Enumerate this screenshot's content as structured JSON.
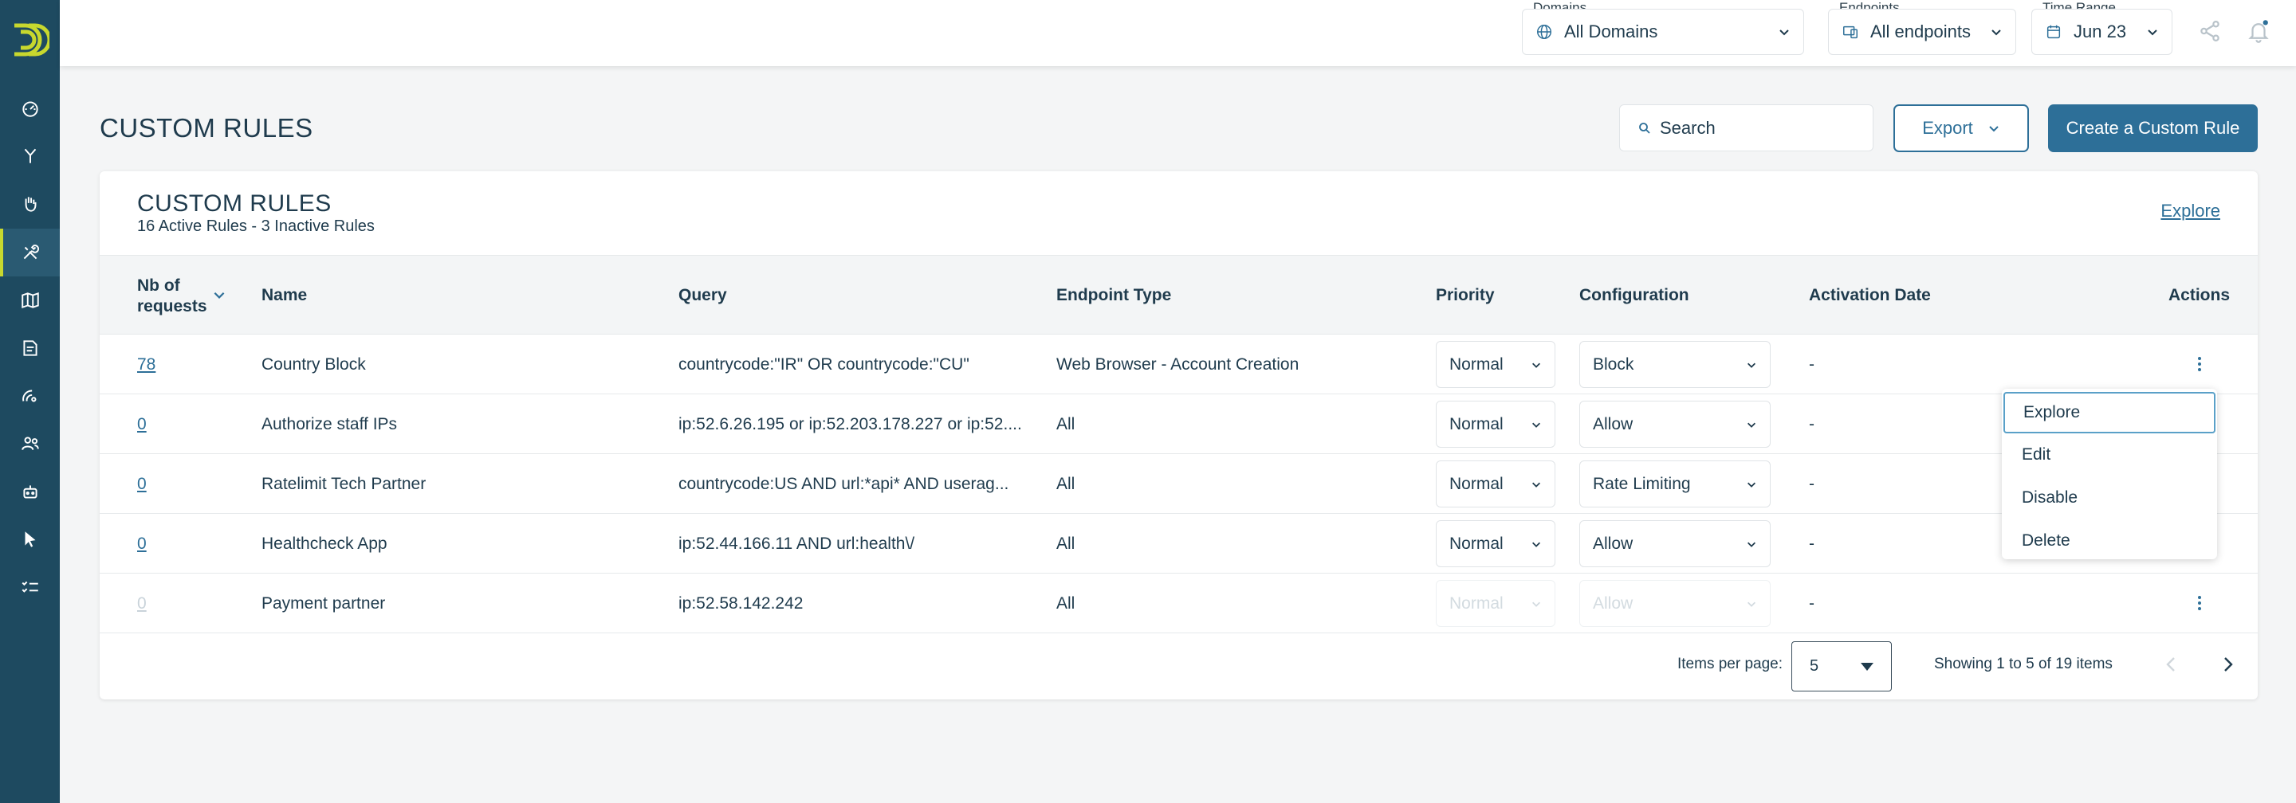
{
  "header": {
    "domains": {
      "label": "Domains",
      "value": "All Domains",
      "icon": "globe-icon"
    },
    "endpoints": {
      "label": "Endpoints",
      "value": "All endpoints",
      "icon": "endpoint-icon"
    },
    "time_range": {
      "label": "Time Range",
      "value": "Jun 23",
      "icon": "calendar-icon"
    },
    "icons": [
      "share-icon",
      "bell-icon"
    ],
    "notification_dot_color": "#2d6f98"
  },
  "sidebar": {
    "items": [
      {
        "icon": "dashboard-icon"
      },
      {
        "icon": "branch-icon"
      },
      {
        "icon": "hand-icon"
      },
      {
        "icon": "tools-icon",
        "active": true
      },
      {
        "icon": "map-icon"
      },
      {
        "icon": "document-icon"
      },
      {
        "icon": "radar-icon"
      },
      {
        "icon": "users-icon"
      },
      {
        "icon": "robot-icon"
      },
      {
        "icon": "cursor-icon"
      },
      {
        "icon": "checklist-icon"
      }
    ]
  },
  "page": {
    "title": "CUSTOM RULES",
    "search_placeholder": "Search",
    "export_label": "Export",
    "create_label": "Create a Custom Rule"
  },
  "card": {
    "title": "CUSTOM RULES",
    "subtitle": "16 Active Rules - 3 Inactive Rules",
    "explore_link": "Explore"
  },
  "table": {
    "columns": {
      "requests_line1": "Nb of",
      "requests_line2": "requests",
      "name": "Name",
      "query": "Query",
      "endpoint_type": "Endpoint Type",
      "priority": "Priority",
      "configuration": "Configuration",
      "activation_date": "Activation Date",
      "actions": "Actions"
    },
    "rows": [
      {
        "requests": "78",
        "name": "Country Block",
        "query": "countrycode:\"IR\" OR countrycode:\"CU\"",
        "endpoint_type": "Web Browser - Account Creation",
        "priority": "Normal",
        "configuration": "Block",
        "activation_date": "-",
        "active": true
      },
      {
        "requests": "0",
        "name": "Authorize staff IPs",
        "query": "ip:52.6.26.195 or ip:52.203.178.227 or ip:52....",
        "endpoint_type": "All",
        "priority": "Normal",
        "configuration": "Allow",
        "activation_date": "-",
        "active": true
      },
      {
        "requests": "0",
        "name": "Ratelimit Tech Partner",
        "query": "countrycode:US AND url:*api* AND userag...",
        "endpoint_type": "All",
        "priority": "Normal",
        "configuration": "Rate Limiting",
        "activation_date": "-",
        "active": true
      },
      {
        "requests": "0",
        "name": "Healthcheck App",
        "query": "ip:52.44.166.11 AND url:health\\/",
        "endpoint_type": "All",
        "priority": "Normal",
        "configuration": "Allow",
        "activation_date": "-",
        "active": true
      },
      {
        "requests": "0",
        "name": "Payment partner",
        "query": "ip:52.58.142.242",
        "endpoint_type": "All",
        "priority": "Normal",
        "configuration": "Allow",
        "activation_date": "-",
        "active": false
      }
    ]
  },
  "actions_menu": {
    "items": [
      "Explore",
      "Edit",
      "Disable",
      "Delete"
    ],
    "focused_index": 0
  },
  "pagination": {
    "items_per_page_label": "Items per page:",
    "items_per_page": "5",
    "info": "Showing 1 to 5 of 19 items"
  },
  "colors": {
    "sidebar": "#1e4a60",
    "accent": "#2d6f98",
    "logo": "#c8d82e"
  }
}
